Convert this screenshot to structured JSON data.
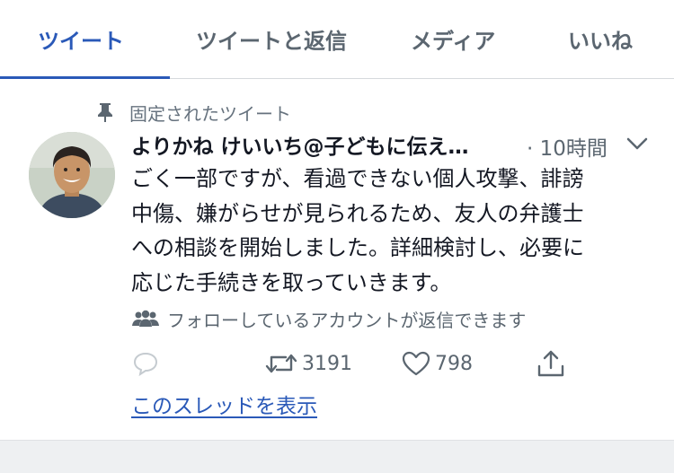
{
  "tabs": [
    {
      "label": "ツイート",
      "active": true
    },
    {
      "label": "ツイートと返信",
      "active": false
    },
    {
      "label": "メディア",
      "active": false
    },
    {
      "label": "いいね",
      "active": false
    }
  ],
  "tweet": {
    "pinned_label": "固定されたツイート",
    "author": "よりかね けいいち@子どもに伝え…",
    "time": "· 10時間",
    "text": "ごく一部ですが、看過できない個人攻撃、誹謗\n中傷、嫌がらせが見られるため、友人の弁護士\nへの相談を開始しました。詳細検討し、必要に\n応じた手続きを取っていきます。",
    "reply_restriction": "フォローしているアカウントが返信できます",
    "retweet_count": "3191",
    "like_count": "798",
    "show_thread": "このスレッドを表示"
  },
  "colors": {
    "accent": "#2a59b8",
    "secondary_text": "#5b6670",
    "primary_text": "#141823"
  },
  "icons": [
    "pin-icon",
    "chevron-down-icon",
    "people-icon",
    "reply-icon",
    "retweet-icon",
    "like-icon",
    "share-icon"
  ]
}
